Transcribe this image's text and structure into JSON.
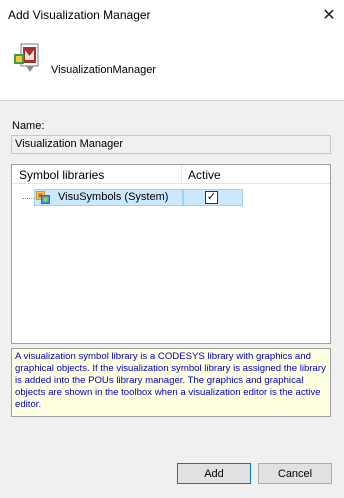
{
  "window": {
    "title": "Add Visualization Manager",
    "close_glyph": "✕"
  },
  "header": {
    "icon": "visualization-manager-icon",
    "label": "VisualizationManager"
  },
  "form": {
    "name_label": "Name:",
    "name_value": "Visualization Manager"
  },
  "table": {
    "columns": [
      "Symbol libraries",
      "Active"
    ],
    "rows": [
      {
        "icon": "library-icon",
        "label": "VisuSymbols (System)",
        "active": true,
        "check_glyph": "✓"
      }
    ]
  },
  "description": "A visualization symbol library is a CODESYS library with graphics and graphical objects. If the visualization symbol library is assigned the library is added into the POUs library manager. The graphics and graphical objects are shown in the toolbox when a visualization editor is the active editor.",
  "buttons": {
    "add": "Add",
    "cancel": "Cancel"
  },
  "colors": {
    "selection": "#cce8ff",
    "description_bg": "#ffffe1",
    "description_text": "#0000c8",
    "primary_border": "#0078d7"
  }
}
